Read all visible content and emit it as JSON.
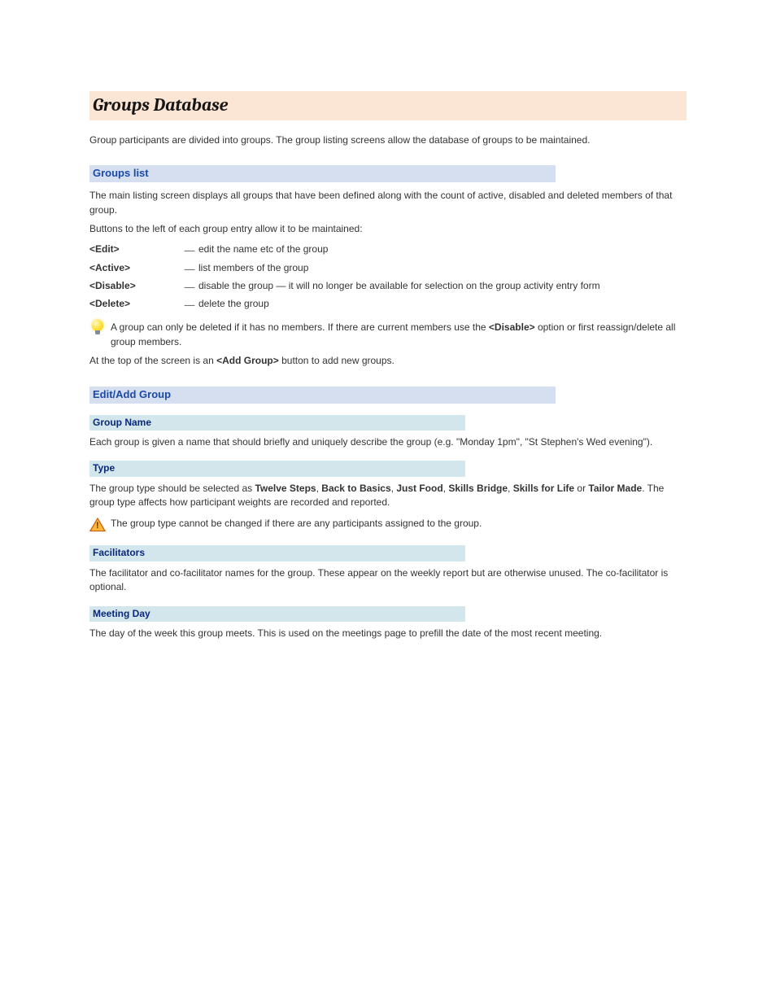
{
  "title": "Groups Database",
  "intro": "Group participants are divided into groups. The group listing screens allow the database of groups to be maintained.",
  "sections": {
    "groups_list": {
      "heading": "Groups list",
      "p1": "The main listing screen displays all groups that have been defined along with the count of active, disabled and deleted members of that group.",
      "p2": "Buttons to the left of each group entry allow it to be maintained:",
      "buttons": [
        {
          "label": "<Edit>",
          "desc": "edit the name etc of the group"
        },
        {
          "label": "<Active>",
          "desc": "list members of the group"
        },
        {
          "label": "<Disable>",
          "desc": "disable the group — it will no longer be available for selection on the group activity entry form"
        },
        {
          "label": "<Delete>",
          "desc": "delete the group"
        }
      ],
      "tip_html": "A group can only be deleted if it has no members. If there are current members use the <b>&lt;Disable&gt;</b> option or first reassign/delete all group members.",
      "p3": "At the top of the screen is an ",
      "add_btn": "<Add Group>",
      "p3_tail": " button to add new groups."
    },
    "edit_add_group": {
      "heading": "Edit/Add Group"
    },
    "group_name": {
      "heading": "Group Name",
      "body": "Each group is given a name that should briefly and uniquely describe the group (e.g. \"Monday 1pm\", \"St Stephen's Wed evening\")."
    },
    "type": {
      "heading": "Type",
      "body_html": "The group type should be selected as <b>Twelve Steps</b>, <b>Back to Basics</b>, <b>Just Food</b>, <b>Skills Bridge</b>, <b>Skills for Life</b> or <b>Tailor Made</b>. The group type affects how participant weights are recorded and reported.",
      "warning": "The group type cannot be changed if there are any participants assigned to the group."
    },
    "facilitators": {
      "heading": "Facilitators",
      "body": "The facilitator and co-facilitator names for the group. These appear on the weekly report but are otherwise unused. The co-facilitator is optional."
    },
    "meeting_day": {
      "heading": "Meeting Day",
      "body": "The day of the week this group meets. This is used on the meetings page to prefill the date of the most recent meeting."
    }
  }
}
